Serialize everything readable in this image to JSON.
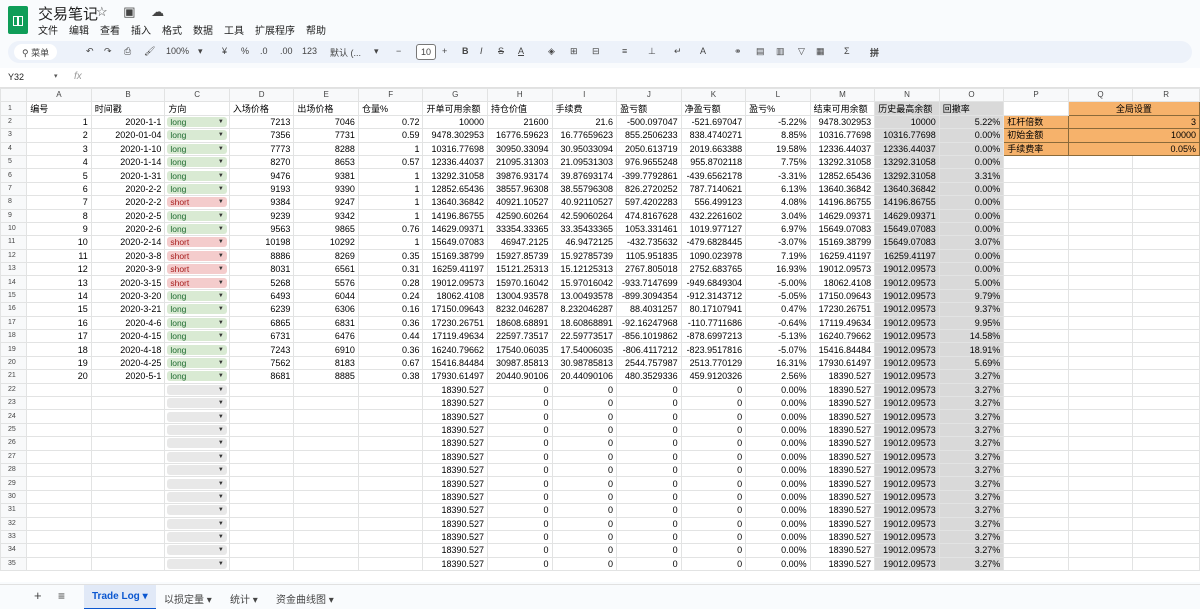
{
  "app": {
    "doc_title": "交易笔记",
    "title_icons": "☆ ▣ ☁"
  },
  "menu": [
    "文件",
    "编辑",
    "查看",
    "插入",
    "格式",
    "数据",
    "工具",
    "扩展程序",
    "帮助"
  ],
  "toolbar": {
    "search": "菜单",
    "zoom": "100%",
    "currency": "¥",
    "percent": "%",
    "dec_less": ".0",
    "dec_more": ".00",
    "format_123": "123",
    "font": "默认 (...",
    "font_size": "10",
    "bold": "B",
    "italic": "I",
    "strike": "S",
    "underline": "A"
  },
  "formula_bar": {
    "cell_ref": "Y32",
    "fx": "fx"
  },
  "columns": [
    "A",
    "B",
    "C",
    "D",
    "E",
    "F",
    "G",
    "H",
    "I",
    "J",
    "K",
    "L",
    "M",
    "N",
    "O",
    "P",
    "Q",
    "R"
  ],
  "row_numbers": [
    "1",
    "2",
    "3",
    "4",
    "5",
    "6",
    "7",
    "8",
    "9",
    "10",
    "11",
    "12",
    "13",
    "14",
    "15",
    "16",
    "17",
    "18",
    "19",
    "20",
    "21",
    "22",
    "23",
    "24",
    "25",
    "26",
    "27",
    "28",
    "29",
    "30",
    "31",
    "32",
    "33",
    "34",
    "35"
  ],
  "headers": [
    "编号",
    "时间戳",
    "方向",
    "入场价格",
    "出场价格",
    "仓量%",
    "开单可用余额",
    "持仓价值",
    "手续费",
    "盈亏额",
    "净盈亏额",
    "盈亏%",
    "结束可用余额",
    "历史最高余额",
    "回撤率"
  ],
  "trades": [
    [
      "1",
      "2020-1-1",
      "long",
      "7213",
      "7046",
      "0.72",
      "10000",
      "21600",
      "21.6",
      "-500.097047",
      "-521.697047",
      "-5.22%",
      "9478.302953",
      "10000",
      "5.22%"
    ],
    [
      "2",
      "2020-01-04",
      "long",
      "7356",
      "7731",
      "0.59",
      "9478.302953",
      "16776.59623",
      "16.77659623",
      "855.2506233",
      "838.4740271",
      "8.85%",
      "10316.77698",
      "10316.77698",
      "0.00%"
    ],
    [
      "3",
      "2020-1-10",
      "long",
      "7773",
      "8288",
      "1",
      "10316.77698",
      "30950.33094",
      "30.95033094",
      "2050.613719",
      "2019.663388",
      "19.58%",
      "12336.44037",
      "12336.44037",
      "0.00%"
    ],
    [
      "4",
      "2020-1-14",
      "long",
      "8270",
      "8653",
      "0.57",
      "12336.44037",
      "21095.31303",
      "21.09531303",
      "976.9655248",
      "955.8702118",
      "7.75%",
      "13292.31058",
      "13292.31058",
      "0.00%"
    ],
    [
      "5",
      "2020-1-31",
      "long",
      "9476",
      "9381",
      "1",
      "13292.31058",
      "39876.93174",
      "39.87693174",
      "-399.7792861",
      "-439.6562178",
      "-3.31%",
      "12852.65436",
      "13292.31058",
      "3.31%"
    ],
    [
      "6",
      "2020-2-2",
      "long",
      "9193",
      "9390",
      "1",
      "12852.65436",
      "38557.96308",
      "38.55796308",
      "826.2720252",
      "787.7140621",
      "6.13%",
      "13640.36842",
      "13640.36842",
      "0.00%"
    ],
    [
      "7",
      "2020-2-2",
      "short",
      "9384",
      "9247",
      "1",
      "13640.36842",
      "40921.10527",
      "40.92110527",
      "597.4202283",
      "556.499123",
      "4.08%",
      "14196.86755",
      "14196.86755",
      "0.00%"
    ],
    [
      "8",
      "2020-2-5",
      "long",
      "9239",
      "9342",
      "1",
      "14196.86755",
      "42590.60264",
      "42.59060264",
      "474.8167628",
      "432.2261602",
      "3.04%",
      "14629.09371",
      "14629.09371",
      "0.00%"
    ],
    [
      "9",
      "2020-2-6",
      "long",
      "9563",
      "9865",
      "0.76",
      "14629.09371",
      "33354.33365",
      "33.35433365",
      "1053.331461",
      "1019.977127",
      "6.97%",
      "15649.07083",
      "15649.07083",
      "0.00%"
    ],
    [
      "10",
      "2020-2-14",
      "short",
      "10198",
      "10292",
      "1",
      "15649.07083",
      "46947.2125",
      "46.9472125",
      "-432.735632",
      "-479.6828445",
      "-3.07%",
      "15169.38799",
      "15649.07083",
      "3.07%"
    ],
    [
      "11",
      "2020-3-8",
      "short",
      "8886",
      "8269",
      "0.35",
      "15169.38799",
      "15927.85739",
      "15.92785739",
      "1105.951835",
      "1090.023978",
      "7.19%",
      "16259.41197",
      "16259.41197",
      "0.00%"
    ],
    [
      "12",
      "2020-3-9",
      "short",
      "8031",
      "6561",
      "0.31",
      "16259.41197",
      "15121.25313",
      "15.12125313",
      "2767.805018",
      "2752.683765",
      "16.93%",
      "19012.09573",
      "19012.09573",
      "0.00%"
    ],
    [
      "13",
      "2020-3-15",
      "short",
      "5268",
      "5576",
      "0.28",
      "19012.09573",
      "15970.16042",
      "15.97016042",
      "-933.7147699",
      "-949.6849304",
      "-5.00%",
      "18062.4108",
      "19012.09573",
      "5.00%"
    ],
    [
      "14",
      "2020-3-20",
      "long",
      "6493",
      "6044",
      "0.24",
      "18062.4108",
      "13004.93578",
      "13.00493578",
      "-899.3094354",
      "-912.3143712",
      "-5.05%",
      "17150.09643",
      "19012.09573",
      "9.79%"
    ],
    [
      "15",
      "2020-3-21",
      "long",
      "6239",
      "6306",
      "0.16",
      "17150.09643",
      "8232.046287",
      "8.232046287",
      "88.4031257",
      "80.17107941",
      "0.47%",
      "17230.26751",
      "19012.09573",
      "9.37%"
    ],
    [
      "16",
      "2020-4-6",
      "long",
      "6865",
      "6831",
      "0.36",
      "17230.26751",
      "18608.68891",
      "18.60868891",
      "-92.16247968",
      "-110.7711686",
      "-0.64%",
      "17119.49634",
      "19012.09573",
      "9.95%"
    ],
    [
      "17",
      "2020-4-15",
      "long",
      "6731",
      "6476",
      "0.44",
      "17119.49634",
      "22597.73517",
      "22.59773517",
      "-856.1019862",
      "-878.6997213",
      "-5.13%",
      "16240.79662",
      "19012.09573",
      "14.58%"
    ],
    [
      "18",
      "2020-4-18",
      "long",
      "7243",
      "6910",
      "0.36",
      "16240.79662",
      "17540.06035",
      "17.54006035",
      "-806.4117212",
      "-823.9517816",
      "-5.07%",
      "15416.84484",
      "19012.09573",
      "18.91%"
    ],
    [
      "19",
      "2020-4-25",
      "long",
      "7562",
      "8183",
      "0.67",
      "15416.84484",
      "30987.85813",
      "30.98785813",
      "2544.757987",
      "2513.770129",
      "16.31%",
      "17930.61497",
      "19012.09573",
      "5.69%"
    ],
    [
      "20",
      "2020-5-1",
      "long",
      "8681",
      "8885",
      "0.38",
      "17930.61497",
      "20440.90106",
      "20.44090106",
      "480.3529336",
      "459.9120326",
      "2.56%",
      "18390.527",
      "19012.09573",
      "3.27%"
    ]
  ],
  "empty_row": {
    "G": "18390.527",
    "H": "0",
    "I": "0",
    "J": "0",
    "K": "0",
    "L": "0.00%",
    "M": "18390.527",
    "N": "19012.09573",
    "O": "3.27%"
  },
  "settings": {
    "title": "全局设置",
    "rows": [
      [
        "杠杆倍数",
        "3"
      ],
      [
        "初始金额",
        "10000"
      ],
      [
        "手续费率",
        "0.05%"
      ]
    ]
  },
  "sheet_tabs": {
    "add": "+",
    "list": "≡",
    "tabs": [
      "Trade Log",
      "以损定量",
      "统计",
      "资金曲线图"
    ],
    "active": "Trade Log"
  },
  "colors": {
    "long_chip": "#d9ead3",
    "short_chip": "#f4cccc",
    "drawdown_fill": "#d9d9d9",
    "settings_fill": "#f6b26b"
  }
}
